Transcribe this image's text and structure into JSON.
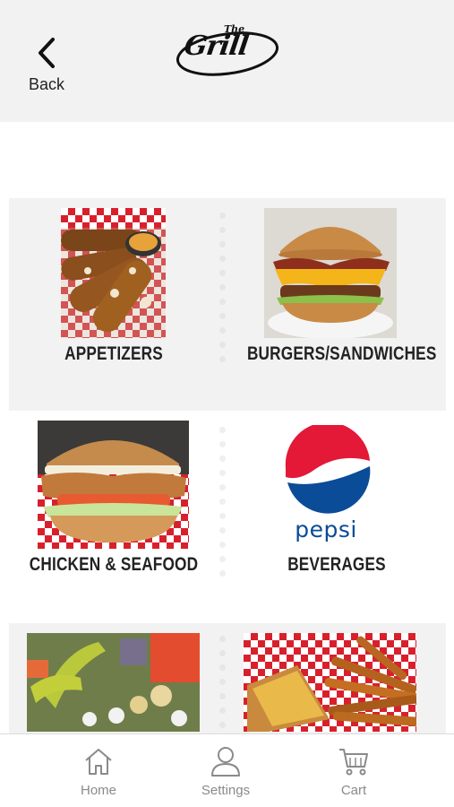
{
  "header": {
    "back_label": "Back",
    "logo_small": "The",
    "logo_main": "Grill"
  },
  "categories": [
    {
      "label": "APPETIZERS",
      "icon": "pretzel-image"
    },
    {
      "label": "BURGERS/SANDWICHES",
      "icon": "burger-image"
    },
    {
      "label": "CHICKEN & SEAFOOD",
      "icon": "chicken-sandwich-image"
    },
    {
      "label": "BEVERAGES",
      "icon": "pepsi-logo",
      "brand_text": "pepsi"
    },
    {
      "label": "",
      "icon": "salad-image"
    },
    {
      "label": "",
      "icon": "grilled-cheese-fries-image"
    }
  ],
  "tabbar": {
    "home": "Home",
    "settings": "Settings",
    "cart": "Cart"
  },
  "colors": {
    "header_bg": "#f2f2f2",
    "checker_red": "#d8202c",
    "pepsi_red": "#e31937",
    "pepsi_blue": "#0a4c97",
    "tab_gray": "#8a8a8a"
  }
}
